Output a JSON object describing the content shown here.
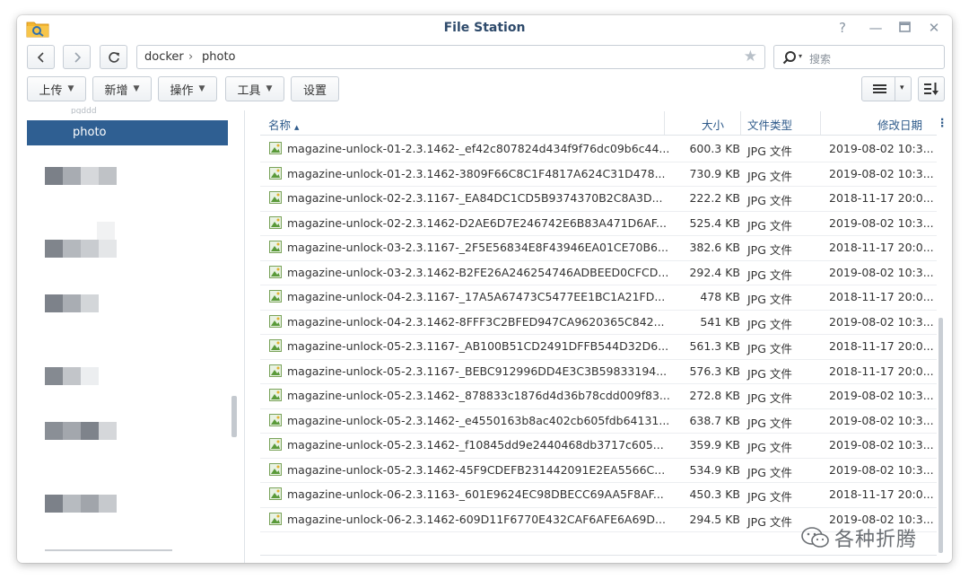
{
  "window": {
    "title": "File Station"
  },
  "nav": {
    "path": [
      "docker",
      "photo"
    ],
    "search_placeholder": "搜索"
  },
  "toolbar": {
    "upload_label": "上传",
    "new_label": "新增",
    "action_label": "操作",
    "tools_label": "工具",
    "settings_label": "设置"
  },
  "sidebar": {
    "partial_item": "pgddd",
    "selected_item": "photo"
  },
  "columns": {
    "name": "名称",
    "sort_indicator": "▲",
    "size": "大小",
    "type": "文件类型",
    "modified": "修改日期"
  },
  "files": [
    {
      "name": "magazine-unlock-01-2.3.1462-_ef42c807824d434f9f76dc09b6c44...",
      "size": "600.3 KB",
      "type": "JPG 文件",
      "date": "2019-08-02 10:3..."
    },
    {
      "name": "magazine-unlock-01-2.3.1462-3809F66C8C1F4817A624C31D478...",
      "size": "730.9 KB",
      "type": "JPG 文件",
      "date": "2019-08-02 10:3..."
    },
    {
      "name": "magazine-unlock-02-2.3.1167-_EA84DC1CD5B9374370B2C8A3D...",
      "size": "222.2 KB",
      "type": "JPG 文件",
      "date": "2018-11-17 20:0..."
    },
    {
      "name": "magazine-unlock-02-2.3.1462-D2AE6D7E246742E6B83A471D6AF...",
      "size": "525.4 KB",
      "type": "JPG 文件",
      "date": "2019-08-02 10:3..."
    },
    {
      "name": "magazine-unlock-03-2.3.1167-_2F5E56834E8F43946EA01CE70B6...",
      "size": "382.6 KB",
      "type": "JPG 文件",
      "date": "2018-11-17 20:0..."
    },
    {
      "name": "magazine-unlock-03-2.3.1462-B2FE26A246254746ADBEED0CFCD...",
      "size": "292.4 KB",
      "type": "JPG 文件",
      "date": "2019-08-02 10:3..."
    },
    {
      "name": "magazine-unlock-04-2.3.1167-_17A5A67473C5477EE1BC1A21FD...",
      "size": "478 KB",
      "type": "JPG 文件",
      "date": "2018-11-17 20:0..."
    },
    {
      "name": "magazine-unlock-04-2.3.1462-8FFF3C2BFED947CA9620365C842...",
      "size": "541 KB",
      "type": "JPG 文件",
      "date": "2019-08-02 10:3..."
    },
    {
      "name": "magazine-unlock-05-2.3.1167-_AB100B51CD2491DFFB544D32D6...",
      "size": "561.3 KB",
      "type": "JPG 文件",
      "date": "2018-11-17 20:0..."
    },
    {
      "name": "magazine-unlock-05-2.3.1167-_BEBC912996DD4E3C3B59833194...",
      "size": "576.3 KB",
      "type": "JPG 文件",
      "date": "2018-11-17 20:0..."
    },
    {
      "name": "magazine-unlock-05-2.3.1462-_878833c1876d4d36b78cdd009f83...",
      "size": "272.8 KB",
      "type": "JPG 文件",
      "date": "2019-08-02 10:3..."
    },
    {
      "name": "magazine-unlock-05-2.3.1462-_e4550163b8ac402cb605fdb64131...",
      "size": "638.7 KB",
      "type": "JPG 文件",
      "date": "2019-08-02 10:3..."
    },
    {
      "name": "magazine-unlock-05-2.3.1462-_f10845dd9e2440468db3717c605...",
      "size": "359.9 KB",
      "type": "JPG 文件",
      "date": "2019-08-02 10:3..."
    },
    {
      "name": "magazine-unlock-05-2.3.1462-45F9CDEFB231442091E2EA5566C...",
      "size": "534.9 KB",
      "type": "JPG 文件",
      "date": "2019-08-02 10:3..."
    },
    {
      "name": "magazine-unlock-06-2.3.1163-_601E9624EC98DBECC69AA5F8AF...",
      "size": "450.3 KB",
      "type": "JPG 文件",
      "date": "2018-11-17 20:0..."
    },
    {
      "name": "magazine-unlock-06-2.3.1462-609D11F6770E432CAF6AFE6A69D...",
      "size": "294.5 KB",
      "type": "JPG 文件",
      "date": "2019-08-02 10:3..."
    }
  ],
  "watermark": "各种折腾",
  "colors": {
    "accent": "#2f5f92",
    "header_text": "#2e5a8a",
    "title_text": "#2e4a6b"
  }
}
